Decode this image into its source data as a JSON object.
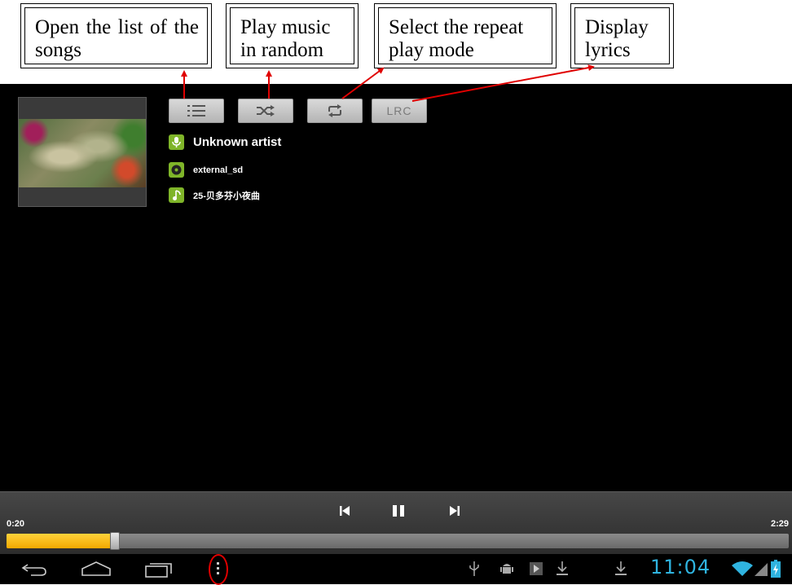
{
  "callouts": {
    "songs_list": "Open the list of the songs",
    "random": "Play music in random",
    "repeat": "Select the repeat play mode",
    "lyrics": "Display lyrics"
  },
  "controls": {
    "list_icon": "list-icon",
    "shuffle_icon": "shuffle-icon",
    "repeat_icon": "repeat-icon",
    "lrc_label": "LRC"
  },
  "track": {
    "artist": "Unknown artist",
    "album": "external_sd",
    "title": "25-贝多芬小夜曲"
  },
  "player": {
    "elapsed": "0:20",
    "duration": "2:29",
    "progress_fraction": 0.139
  },
  "system": {
    "clock": "11:04"
  },
  "colors": {
    "accent": "#7fb529",
    "seek_fill": "#f5b800",
    "clock": "#2fb4e0",
    "annotation": "#e00000"
  }
}
